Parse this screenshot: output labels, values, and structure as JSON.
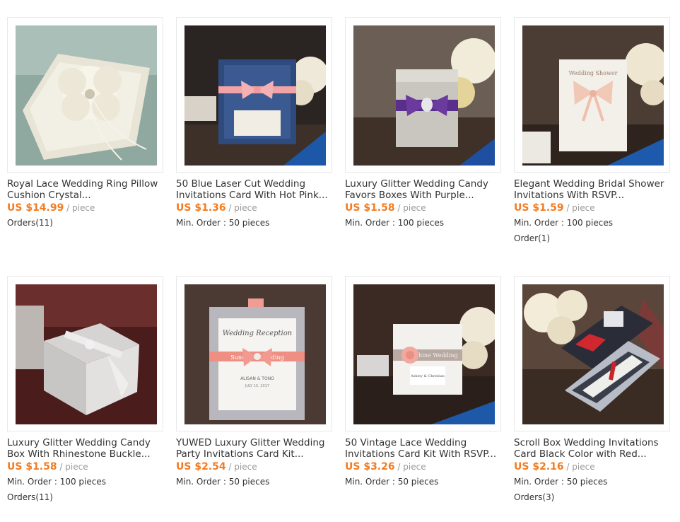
{
  "products": [
    {
      "title1": "Royal Lace Wedding Ring Pillow",
      "title2": "Cushion Crystal...",
      "price": "US $14.99",
      "unit": " / piece",
      "meta1": "Orders(11)",
      "meta2": ""
    },
    {
      "title1": "50 Blue Laser Cut Wedding",
      "title2": "Invitations Card With Hot Pink...",
      "price": "US $1.36",
      "unit": " / piece",
      "meta1": "Min. Order : 50 pieces",
      "meta2": ""
    },
    {
      "title1": "Luxury Glitter Wedding Candy",
      "title2": "Favors Boxes With Purple...",
      "price": "US $1.58",
      "unit": " / piece",
      "meta1": "Min. Order : 100 pieces",
      "meta2": ""
    },
    {
      "title1": "Elegant Wedding Bridal Shower",
      "title2": "Invitations With RSVP...",
      "price": "US $1.59",
      "unit": " / piece",
      "meta1": "Min. Order : 100 pieces",
      "meta2": "Order(1)"
    },
    {
      "title1": "Luxury Glitter Wedding Candy",
      "title2": "Box With Rhinestone Buckle...",
      "price": "US $1.58",
      "unit": " / piece",
      "meta1": "Min. Order : 100 pieces",
      "meta2": "Orders(11)"
    },
    {
      "title1": "YUWED Luxury Glitter Wedding",
      "title2": "Party Invitations Card Kit...",
      "price": "US $2.54",
      "unit": " / piece",
      "meta1": "Min. Order : 50 pieces",
      "meta2": ""
    },
    {
      "title1": "50 Vintage Lace Wedding",
      "title2": "Invitations Card Kit With RSVP...",
      "price": "US $3.26",
      "unit": " / piece",
      "meta1": "Min. Order : 50 pieces",
      "meta2": ""
    },
    {
      "title1": "Scroll Box Wedding Invitations",
      "title2": "Card Black Color with Red...",
      "price": "US $2.16",
      "unit": " / piece",
      "meta1": "Min. Order : 50 pieces",
      "meta2": "Orders(3)"
    }
  ],
  "image_text": {
    "p4_card": "Wedding Shower",
    "p6_heading": "Wedding Reception",
    "p6_ribbon": "Sunshine Wedding",
    "p6_names": "ALISAN & TONO",
    "p6_date": "JULY 15, 2017",
    "p7_ribbon": "Sunshine Wedding",
    "p7_tag": "Ashley & Christian"
  },
  "colors": {
    "price": "#f47b20",
    "unit": "#999999",
    "text": "#333333",
    "border": "#e8e8e8"
  }
}
